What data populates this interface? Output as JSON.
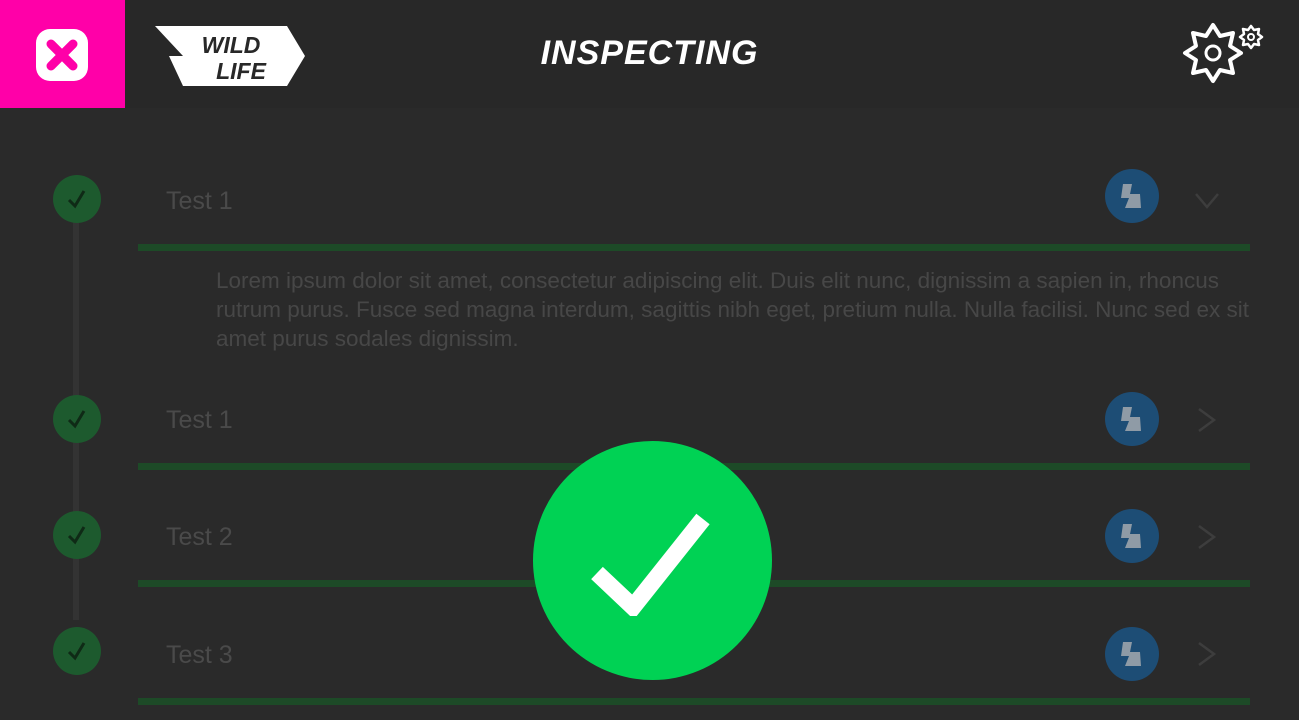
{
  "header": {
    "title": "INSPECTING",
    "logo_text": [
      "WILD",
      "LIFE"
    ],
    "close_icon": "close-icon",
    "settings_icon": "gear-icon",
    "close_color": "#ff00a8"
  },
  "steps": [
    {
      "title": "Test 1",
      "expanded": true,
      "status": "passed",
      "description": "Lorem ipsum dolor sit amet, consectetur adipiscing elit. Duis elit nunc, dignissim a sapien in, rhoncus rutrum purus. Fusce sed magna interdum, sagittis nibh eget, pretium nulla. Nulla facilisi. Nunc sed ex sit amet purus sodales dignissim."
    },
    {
      "title": "Test 1",
      "expanded": false,
      "status": "passed"
    },
    {
      "title": "Test 2",
      "expanded": false,
      "status": "passed"
    },
    {
      "title": "Test 3",
      "expanded": false,
      "status": "passed"
    }
  ],
  "colors": {
    "success": "#00d254",
    "step_check": "#1d5a2e",
    "badge": "#1d4d75",
    "underline": "#1d4a27"
  },
  "overlay": {
    "icon": "checkmark-icon",
    "state": "success"
  }
}
